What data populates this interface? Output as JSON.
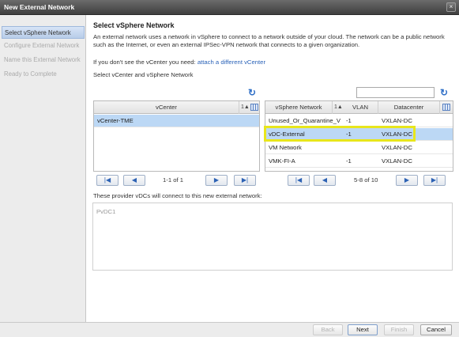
{
  "window": {
    "title": "New External Network",
    "close_glyph": "×"
  },
  "steps": [
    {
      "label": "Select vSphere Network",
      "active": true
    },
    {
      "label": "Configure External Network",
      "active": false
    },
    {
      "label": "Name this External Network",
      "active": false
    },
    {
      "label": "Ready to Complete",
      "active": false
    }
  ],
  "main": {
    "heading": "Select vSphere Network",
    "description": "An external network uses a network in vSphere to connect to a network outside of your cloud. The network can be a public network such as the Internet, or even an external IPSec-VPN network that connects to a given organization.",
    "hint_prefix": "If you don't see the vCenter you need:",
    "hint_link": "attach a different vCenter",
    "sublabel": "Select vCenter and vSphere Network",
    "search_value": "",
    "search_placeholder": ""
  },
  "vcenter_grid": {
    "header": "vCenter",
    "sort_label": "1",
    "sort_arrow": "▲",
    "rows": [
      "vCenter-TME"
    ],
    "pager_label": "1-1 of 1"
  },
  "network_grid": {
    "headers": [
      "vSphere Network",
      "VLAN",
      "Datacenter"
    ],
    "sort_label": "1",
    "sort_arrow": "▲",
    "rows": [
      {
        "network": "Unused_Or_Quarantine_V",
        "vlan": "-1",
        "datacenter": "VXLAN-DC"
      },
      {
        "network": "vDC-External",
        "vlan": "-1",
        "datacenter": "VXLAN-DC"
      },
      {
        "network": "VM Network",
        "vlan": "",
        "datacenter": "VXLAN-DC"
      },
      {
        "network": "VMK-FI-A",
        "vlan": "-1",
        "datacenter": "VXLAN-DC"
      }
    ],
    "pager_label": "5-8 of 10"
  },
  "pager_glyphs": {
    "first": "|◀",
    "prev": "◀",
    "next": "▶",
    "last": "▶|"
  },
  "vdcs": {
    "label": "These provider vDCs will connect to this new external network:",
    "items": [
      "PvDC1"
    ]
  },
  "footer": {
    "back": "Back",
    "next": "Next",
    "finish": "Finish",
    "cancel": "Cancel"
  },
  "colors": {
    "accent": "#2f6fc7",
    "selected_row": "#bcd8f5",
    "highlight": "#e8e61c"
  },
  "icons": {
    "refresh": "↻",
    "column_chooser": "columns-icon"
  }
}
